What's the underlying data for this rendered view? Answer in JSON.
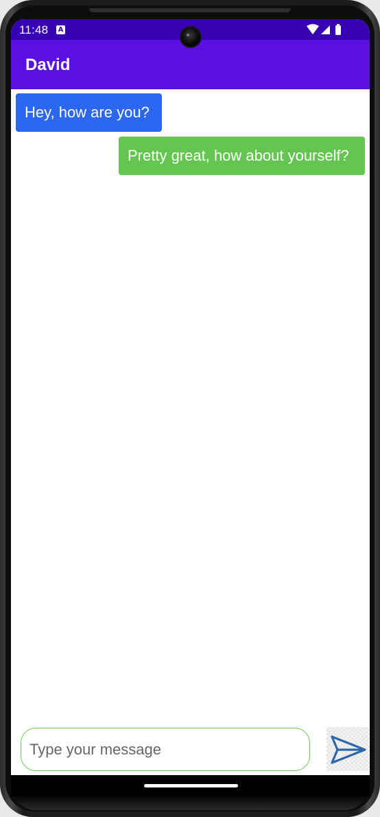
{
  "status_bar": {
    "time": "11:48",
    "notification_icon": "a-icon",
    "wifi_icon": "wifi-icon",
    "signal_icon": "signal-icon",
    "battery_icon": "battery-icon",
    "background_color": "#3700b3"
  },
  "app_bar": {
    "title": "David",
    "background_color": "#5b10e0"
  },
  "messages": [
    {
      "text": "Hey, how are you?",
      "direction": "received",
      "color": "#2b68ef"
    },
    {
      "text": "Pretty great, how about yourself?",
      "direction": "sent",
      "color": "#64c650"
    }
  ],
  "composer": {
    "placeholder": "Type your message",
    "value": "",
    "send_icon": "send-icon",
    "accent_color": "#6cc84f"
  }
}
